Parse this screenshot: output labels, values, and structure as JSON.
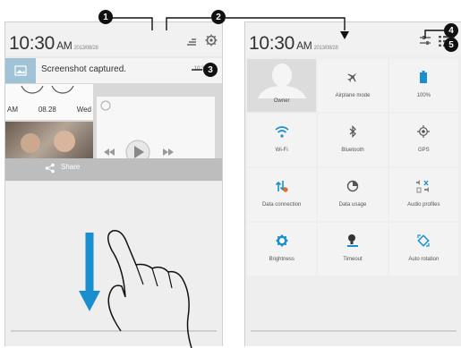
{
  "callouts": [
    "1",
    "2",
    "3",
    "4",
    "5"
  ],
  "left_panel": {
    "time": "10:30",
    "ampm": "AM",
    "date": "2013/08/28",
    "notification": {
      "text": "Screenshot captured.",
      "time": "10:30 AM"
    },
    "clock_widget": {
      "ampm": "AM",
      "date": "08.28",
      "day": "Wed"
    },
    "share_label": "Share"
  },
  "right_panel": {
    "time": "10:30",
    "ampm": "AM",
    "date": "2013/08/28",
    "owner_label": "Owner",
    "tiles": [
      {
        "label": "Airplane mode",
        "icon": "airplane-icon"
      },
      {
        "label": "100%",
        "icon": "battery-icon"
      },
      {
        "label": "Wi-Fi",
        "icon": "wifi-icon"
      },
      {
        "label": "Bluetooth",
        "icon": "bluetooth-icon"
      },
      {
        "label": "GPS",
        "icon": "gps-icon"
      },
      {
        "label": "Data connection",
        "icon": "data-connection-icon"
      },
      {
        "label": "Data usage",
        "icon": "data-usage-icon"
      },
      {
        "label": "Audio profiles",
        "icon": "audio-profiles-icon"
      },
      {
        "label": "Brightness",
        "icon": "brightness-icon"
      },
      {
        "label": "Timeout",
        "icon": "timeout-icon"
      },
      {
        "label": "Auto rotation",
        "icon": "auto-rotation-icon"
      }
    ]
  },
  "colors": {
    "accent_blue": "#1a8fd0",
    "notification_icon_bg": "#9fc2d6",
    "callout_black": "#111111",
    "orange": "#e86a1f"
  }
}
